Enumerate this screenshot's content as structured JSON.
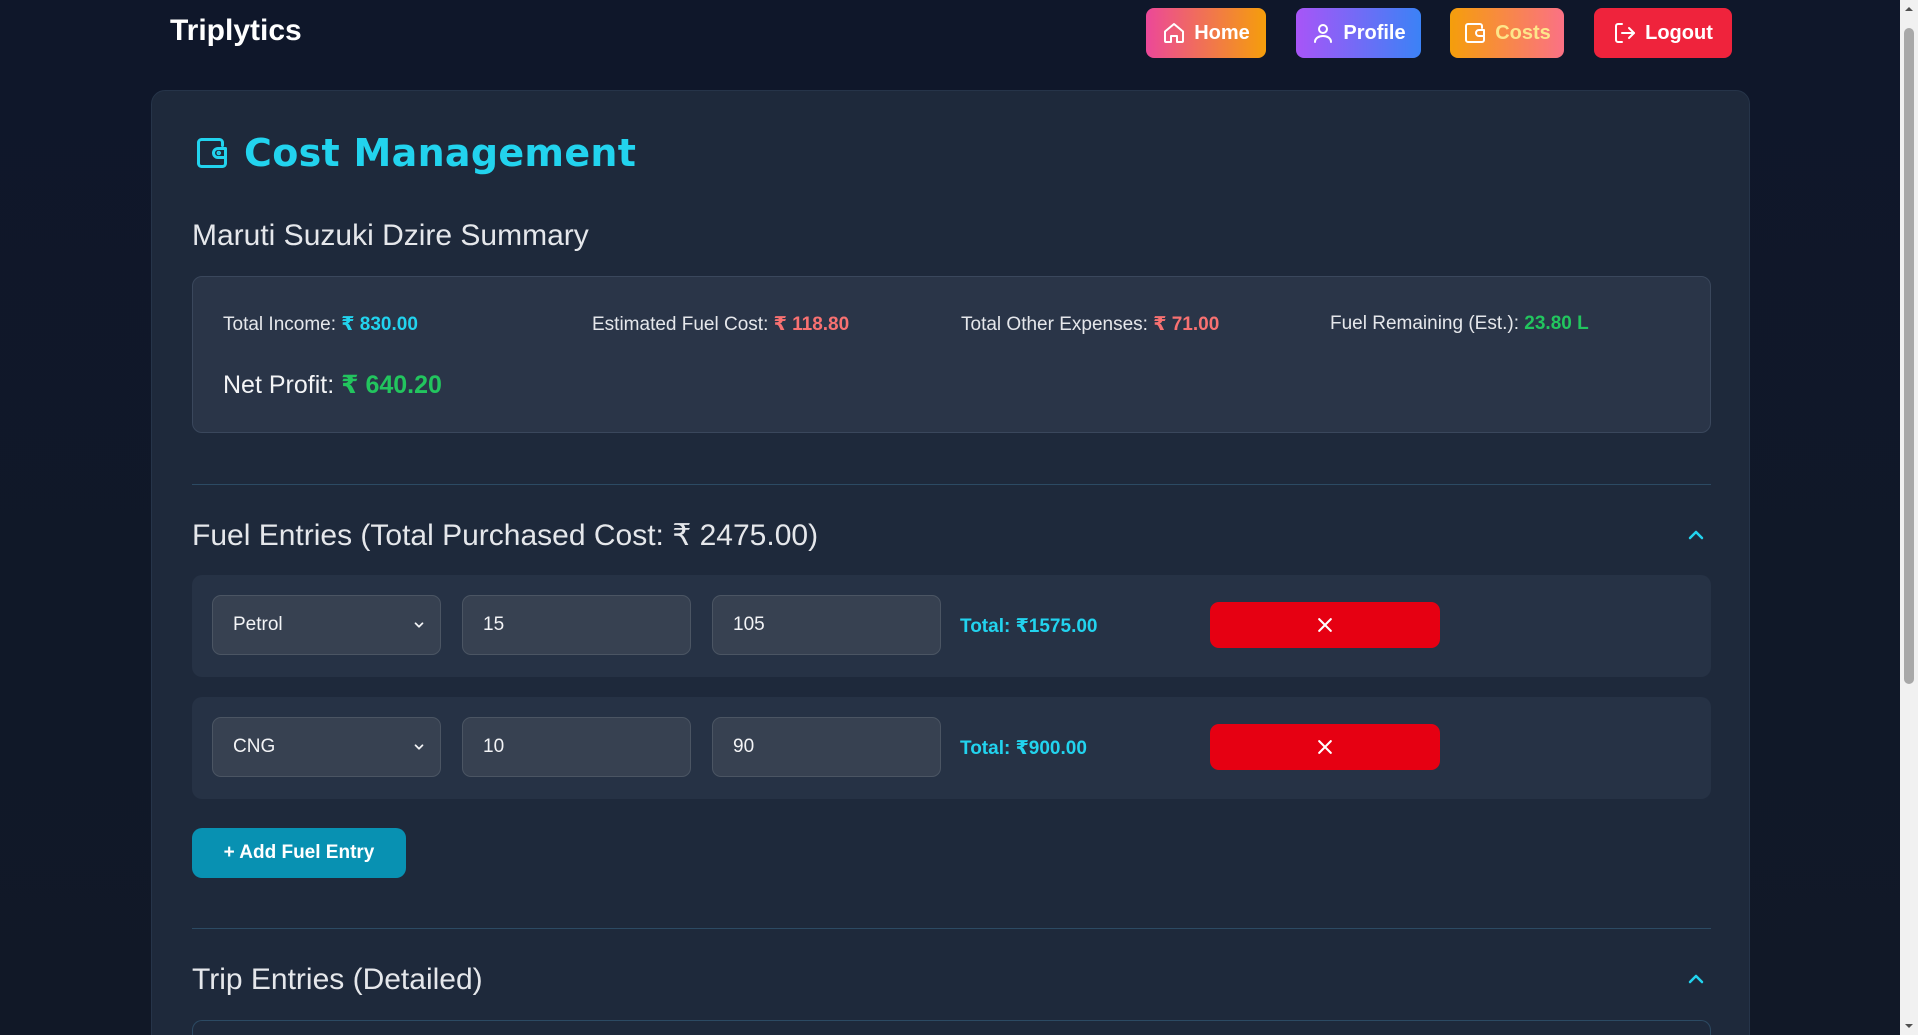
{
  "app": {
    "brand": "Triplytics"
  },
  "nav": {
    "home": "Home",
    "profile": "Profile",
    "costs": "Costs",
    "logout": "Logout"
  },
  "page": {
    "title": "Cost Management",
    "summary_heading": "Maruti Suzuki Dzire Summary"
  },
  "summary": {
    "total_income_label": "Total Income:",
    "total_income_value": "₹ 830.00",
    "fuel_cost_label": "Estimated Fuel Cost:",
    "fuel_cost_value": "₹ 118.80",
    "other_expenses_label": "Total Other Expenses:",
    "other_expenses_value": "₹ 71.00",
    "fuel_remaining_label": "Fuel Remaining (Est.):",
    "fuel_remaining_value": "23.80 L",
    "net_profit_label": "Net Profit:",
    "net_profit_value": "₹ 640.20"
  },
  "fuel_section": {
    "heading": "Fuel Entries (Total Purchased Cost: ₹ 2475.00)",
    "entries": [
      {
        "type": "Petrol",
        "quantity": "15",
        "price": "105",
        "total": "Total: ₹1575.00"
      },
      {
        "type": "CNG",
        "quantity": "10",
        "price": "90",
        "total": "Total: ₹900.00"
      }
    ],
    "add_label": "+ Add Fuel Entry"
  },
  "trip_section": {
    "heading": "Trip Entries (Detailed)"
  },
  "colors": {
    "accent": "#22d3ee",
    "danger": "#e60012",
    "success": "#22c55e",
    "expense": "#f87171"
  }
}
